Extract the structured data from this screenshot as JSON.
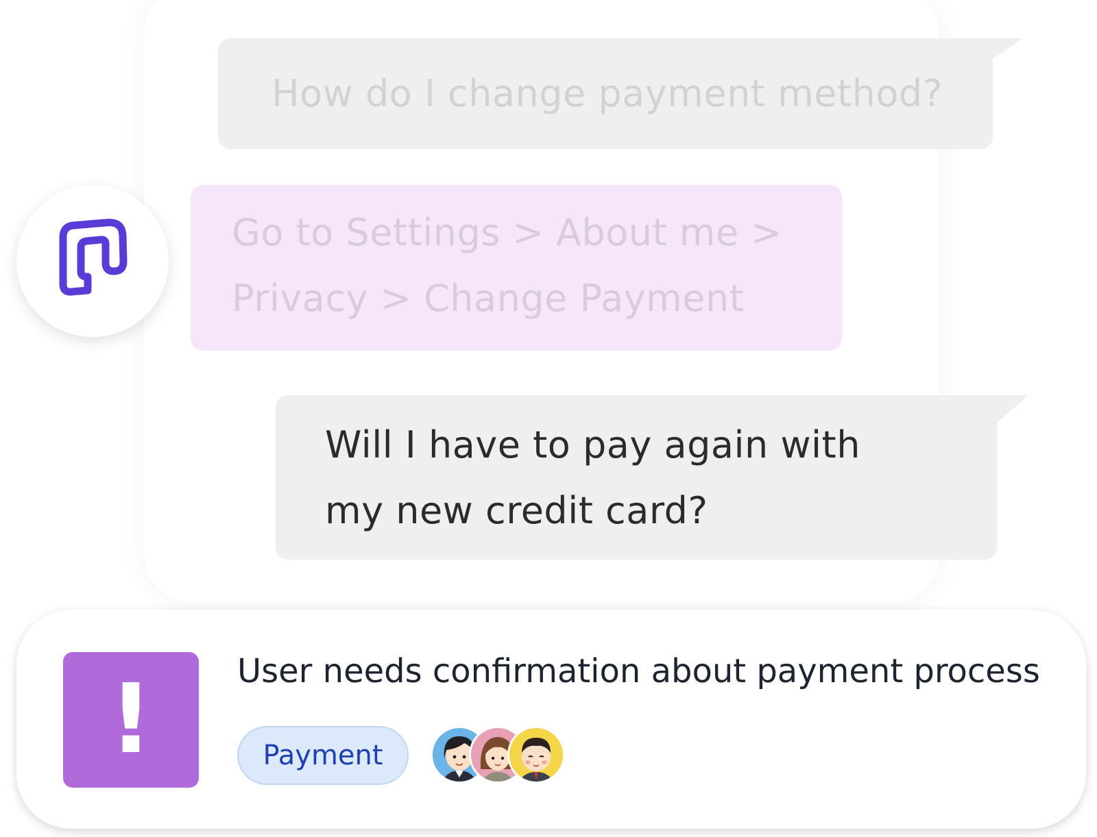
{
  "chat": {
    "messages": [
      {
        "role": "user",
        "lines": [
          "How do I change payment method?"
        ]
      },
      {
        "role": "bot",
        "lines": [
          "Go to Settings > About me >",
          "Privacy > Change Payment"
        ]
      },
      {
        "role": "user",
        "lines": [
          "Will I have to pay again with",
          "my new credit card?"
        ]
      }
    ]
  },
  "alert": {
    "icon": "!",
    "icon_color": "#b06ad9",
    "text": "User needs confirmation about payment process",
    "tag": "Payment",
    "tag_color": "#1d3fb0",
    "assignees": [
      "agent-woman-avatar",
      "agent-woman-avatar",
      "agent-man-avatar"
    ]
  },
  "colors": {
    "brand": "#5b3bd6",
    "user_bubble": "#efefef",
    "bot_bubble": "#f6e6fc"
  }
}
